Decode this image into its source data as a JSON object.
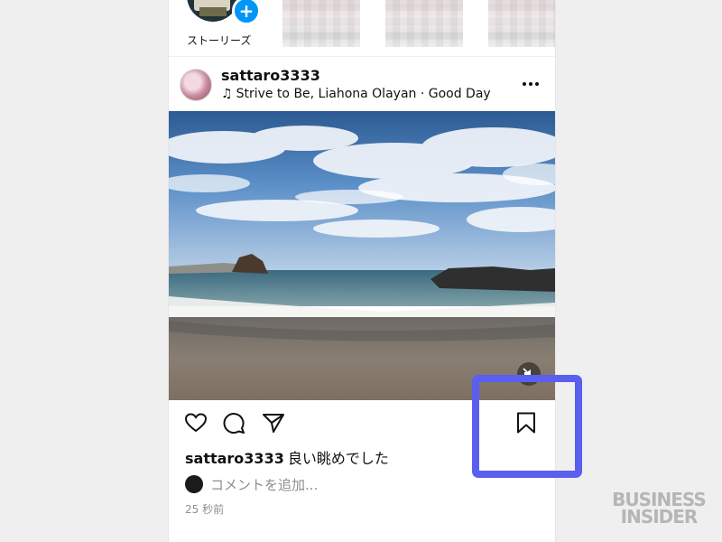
{
  "stories": {
    "own_label": "ストーリーズ",
    "add_icon": "plus-icon"
  },
  "post": {
    "username": "sattaro3333",
    "music": "Strive to Be, Liahona Olayan · Good Day",
    "music_icon": "music-note-icon",
    "more_icon": "more-options-icon",
    "caption_user": "sattaro3333",
    "caption_text": "良い眺めでした",
    "comment_placeholder": "コメントを追加...",
    "timestamp": "25 秒前",
    "actions": [
      "like-icon",
      "comment-icon",
      "share-icon",
      "save-icon"
    ]
  },
  "watermark": {
    "line1": "BUSINESS",
    "line2": "INSIDER"
  },
  "colors": {
    "accent_blue": "#0095f6",
    "highlight_box": "#5b5ff0",
    "page_bg": "#efefef"
  }
}
